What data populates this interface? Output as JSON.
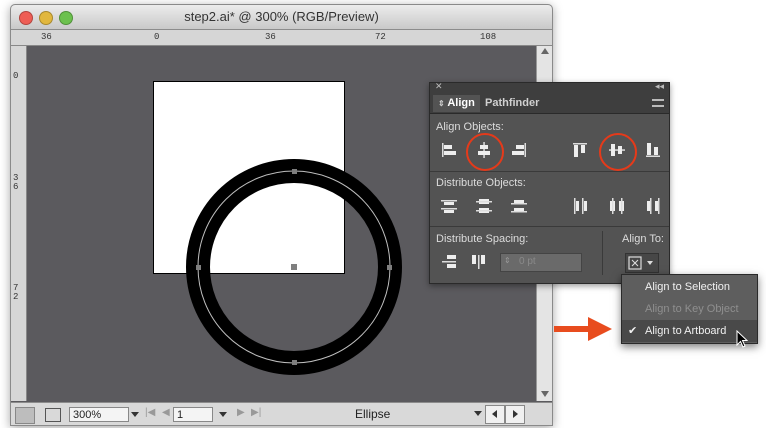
{
  "window": {
    "title": "step2.ai* @ 300% (RGB/Preview)"
  },
  "rulers": {
    "top_labels": [
      "36",
      "0",
      "36",
      "72",
      "108"
    ],
    "left_labels": [
      "0",
      "3\n6",
      "7\n2"
    ]
  },
  "status_bar": {
    "zoom": "300%",
    "artboard": "1",
    "selection_info": "Ellipse"
  },
  "align_panel": {
    "tabs": [
      "Align",
      "Pathfinder"
    ],
    "align_objects_label": "Align Objects:",
    "distribute_objects_label": "Distribute Objects:",
    "distribute_spacing_label": "Distribute Spacing:",
    "align_to_label": "Align To:",
    "spacing_value": "0 pt",
    "highlight_color": "#e53a1a"
  },
  "align_to_menu": {
    "items": [
      {
        "label": "Align to Selection",
        "enabled": true,
        "checked": false
      },
      {
        "label": "Align to Key Object",
        "enabled": false,
        "checked": false
      },
      {
        "label": "Align to Artboard",
        "enabled": true,
        "checked": true
      }
    ],
    "check_mark": "✔"
  },
  "colors": {
    "canvas": "#5b5a5e",
    "artboard": "#ffffff",
    "panel": "#535353",
    "arrow": "#e84c1e"
  }
}
